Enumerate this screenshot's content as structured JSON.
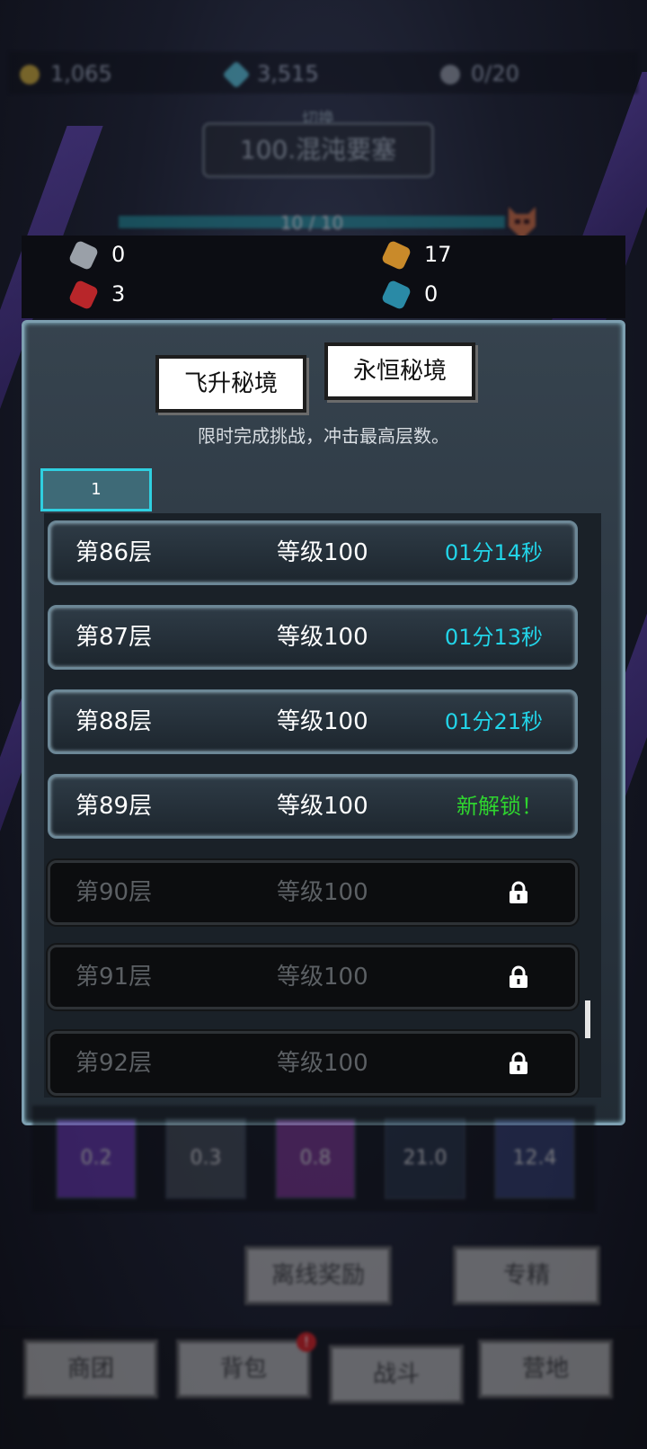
{
  "top_resources": {
    "gold": "1,065",
    "diamond": "3,515",
    "stamina": "0/20"
  },
  "location": {
    "switch_label": "切换",
    "name": "100.混沌要塞"
  },
  "wave_progress": {
    "label": "10 / 10",
    "value": 1.0
  },
  "materials": [
    {
      "icon": "gray-ore-icon",
      "count": "0"
    },
    {
      "icon": "gold-rune-icon",
      "count": "17"
    },
    {
      "icon": "red-ore-icon",
      "count": "3"
    },
    {
      "icon": "blue-rune-icon",
      "count": "0"
    }
  ],
  "panel": {
    "tabs": [
      {
        "label": "飞升秘境"
      },
      {
        "label": "永恒秘境"
      }
    ],
    "subtitle": "限时完成挑战，冲击最高层数。",
    "page": "1",
    "floors": [
      {
        "floor": "第86层",
        "level": "等级100",
        "status": "01分14秒",
        "state": "time"
      },
      {
        "floor": "第87层",
        "level": "等级100",
        "status": "01分13秒",
        "state": "time"
      },
      {
        "floor": "第88层",
        "level": "等级100",
        "status": "01分21秒",
        "state": "time"
      },
      {
        "floor": "第89层",
        "level": "等级100",
        "status": "新解锁！",
        "state": "new"
      },
      {
        "floor": "第90层",
        "level": "等级100",
        "status": "",
        "state": "locked"
      },
      {
        "floor": "第91层",
        "level": "等级100",
        "status": "",
        "state": "locked"
      },
      {
        "floor": "第92层",
        "level": "等级100",
        "status": "",
        "state": "locked"
      }
    ]
  },
  "skills": [
    {
      "value": "0.2"
    },
    {
      "value": "0.3"
    },
    {
      "value": "0.8"
    },
    {
      "value": "21.0"
    },
    {
      "value": "12.4"
    }
  ],
  "actions": {
    "offline_reward": "离线奖励",
    "specialize": "专精"
  },
  "nav": [
    {
      "label": "商团"
    },
    {
      "label": "背包",
      "badge": "!"
    },
    {
      "label": "战斗"
    },
    {
      "label": "营地"
    }
  ],
  "colors": {
    "time": "#22d4e8",
    "new": "#2fd42f",
    "page_border": "#2fcfe0"
  }
}
